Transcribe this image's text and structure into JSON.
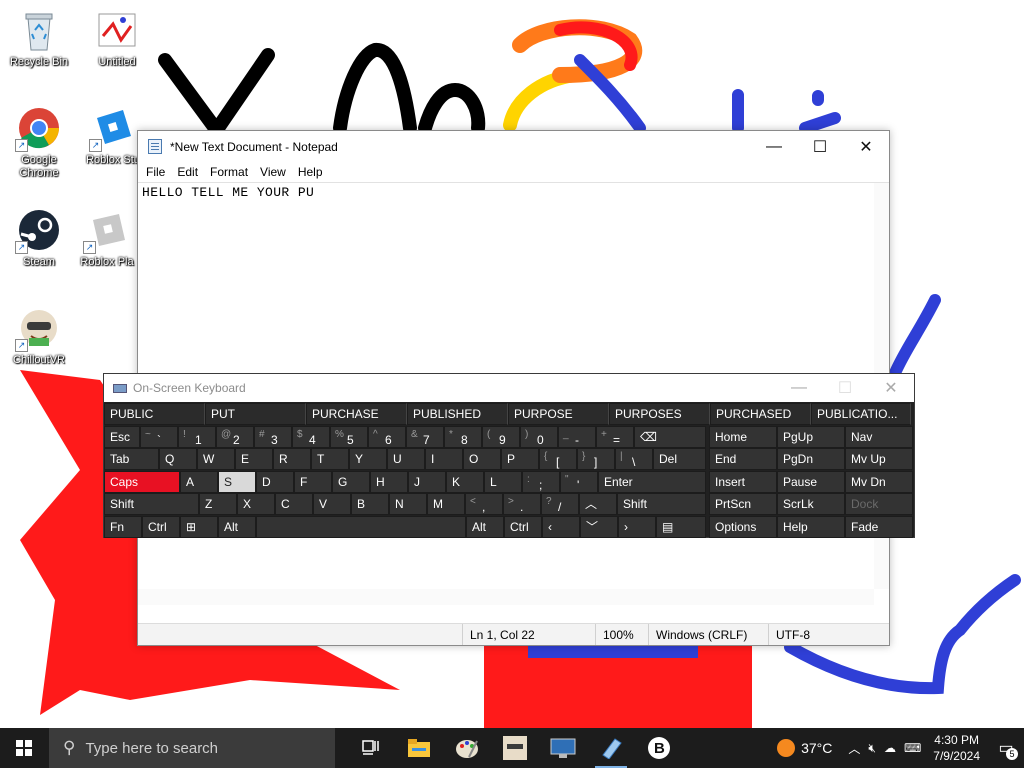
{
  "desktop": {
    "icons": [
      {
        "label": "Recycle Bin",
        "icon": "recycle-bin-icon"
      },
      {
        "label": "Untitled",
        "icon": "paint-file-icon"
      },
      {
        "label": "Google Chrome",
        "icon": "chrome-icon"
      },
      {
        "label": "Roblox Stu",
        "icon": "roblox-studio-icon"
      },
      {
        "label": "Steam",
        "icon": "steam-icon"
      },
      {
        "label": "Roblox Pla",
        "icon": "roblox-player-icon"
      },
      {
        "label": "ChilloutVR",
        "icon": "chilloutvr-icon"
      }
    ]
  },
  "notepad": {
    "title": "*New Text Document - Notepad",
    "menu": [
      "File",
      "Edit",
      "Format",
      "View",
      "Help"
    ],
    "content": "HELLO TELL ME YOUR PU",
    "status": {
      "position": "Ln 1, Col 22",
      "zoom": "100%",
      "line_ending": "Windows (CRLF)",
      "encoding": "UTF-8"
    }
  },
  "osk": {
    "title": "On-Screen Keyboard",
    "predictions": [
      "PUBLIC",
      "PUT",
      "PURCHASE",
      "PUBLISHED",
      "PURPOSE",
      "PURPOSES",
      "PURCHASED",
      "PUBLICATIO..."
    ],
    "keys": {
      "esc": "Esc",
      "tab": "Tab",
      "caps": "Caps",
      "shift": "Shift",
      "shift_r": "Shift",
      "fn": "Fn",
      "ctrl": "Ctrl",
      "ctrl_r": "Ctrl",
      "alt": "Alt",
      "alt_r": "Alt",
      "del": "Del",
      "enter": "Enter",
      "home": "Home",
      "pgup": "PgUp",
      "nav": "Nav",
      "end": "End",
      "pgdn": "PgDn",
      "mvup": "Mv Up",
      "insert": "Insert",
      "pause": "Pause",
      "mvdn": "Mv Dn",
      "prtscn": "PrtScn",
      "scrlk": "ScrLk",
      "dock": "Dock",
      "options": "Options",
      "help": "Help",
      "fade": "Fade"
    },
    "num_row": [
      {
        "sub": "~",
        "main": "`"
      },
      {
        "sub": "!",
        "main": "1"
      },
      {
        "sub": "@",
        "main": "2"
      },
      {
        "sub": "#",
        "main": "3"
      },
      {
        "sub": "$",
        "main": "4"
      },
      {
        "sub": "%",
        "main": "5"
      },
      {
        "sub": "^",
        "main": "6"
      },
      {
        "sub": "&",
        "main": "7"
      },
      {
        "sub": "*",
        "main": "8"
      },
      {
        "sub": "(",
        "main": "9"
      },
      {
        "sub": ")",
        "main": "0"
      },
      {
        "sub": "_",
        "main": "-"
      },
      {
        "sub": "+",
        "main": "="
      }
    ],
    "q_row": [
      "Q",
      "W",
      "E",
      "R",
      "T",
      "Y",
      "U",
      "I",
      "O",
      "P"
    ],
    "q_row_sym": [
      {
        "sub": "{",
        "main": "["
      },
      {
        "sub": "}",
        "main": "]"
      },
      {
        "sub": "|",
        "main": "\\"
      }
    ],
    "a_row": [
      "A",
      "S",
      "D",
      "F",
      "G",
      "H",
      "J",
      "K",
      "L"
    ],
    "a_row_sym": [
      {
        "sub": ":",
        "main": ";"
      },
      {
        "sub": "\"",
        "main": "'"
      }
    ],
    "z_row": [
      "Z",
      "X",
      "C",
      "V",
      "B",
      "N",
      "M"
    ],
    "z_row_sym": [
      {
        "sub": "<",
        "main": ","
      },
      {
        "sub": ">",
        "main": "."
      },
      {
        "sub": "?",
        "main": "/"
      }
    ]
  },
  "taskbar": {
    "search_placeholder": "Type here to search",
    "weather": "37°C",
    "time": "4:30 PM",
    "date": "7/9/2024",
    "notifications": "5"
  },
  "colors": {
    "caps_active": "#e81123",
    "taskbar": "#1c1c1c",
    "osk_bg": "#212121"
  }
}
